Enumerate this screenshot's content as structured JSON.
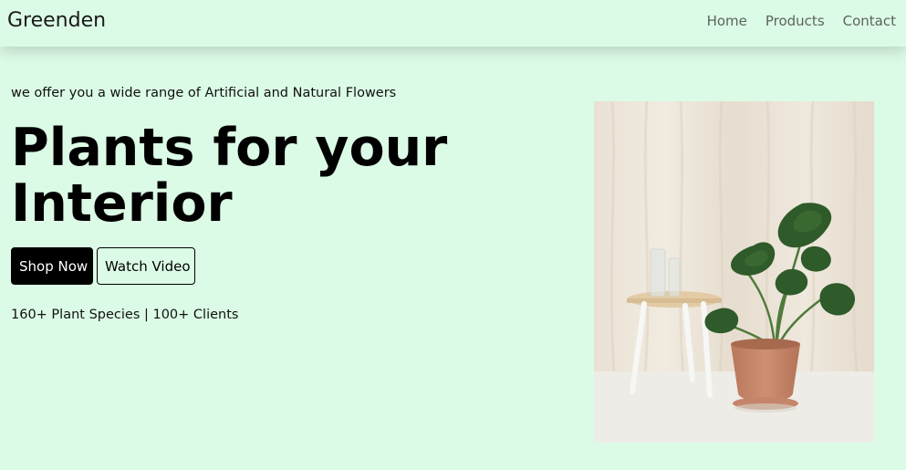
{
  "nav": {
    "brand": "Greenden",
    "links": [
      {
        "label": "Home"
      },
      {
        "label": "Products"
      },
      {
        "label": "Contact"
      }
    ]
  },
  "hero": {
    "tagline": "we offer you a wide range of Artificial and Natural Flowers",
    "headline_line1": "Plants for your",
    "headline_line2": "Interior",
    "primary_button": "Shop Now",
    "secondary_button": "Watch Video",
    "stats": "160+ Plant Species | 100+ Clients"
  },
  "colors": {
    "background": "#dcfbe6",
    "primary_button_bg": "#000000",
    "nav_link": "#5c6360"
  },
  "icons": {
    "hero_image": "monstera-plant-in-pot-photo"
  }
}
